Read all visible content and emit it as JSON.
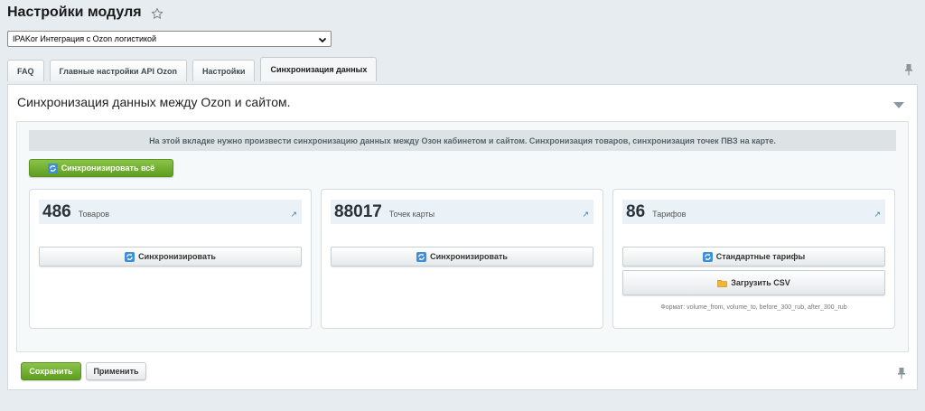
{
  "page": {
    "title": "Настройки модуля"
  },
  "module_select": {
    "value": "IPAKor Интеграция с Ozon логистикой"
  },
  "tabs": [
    {
      "label": "FAQ",
      "active": false
    },
    {
      "label": "Главные настройки API Ozon",
      "active": false
    },
    {
      "label": "Настройки",
      "active": false
    },
    {
      "label": "Синхронизация данных",
      "active": true
    }
  ],
  "panel": {
    "title": "Синхронизация данных между Ozon и сайтом.",
    "notice": "На этой вкладке нужно произвести синхронизацию данных между Озон кабинетом и сайтом. Синхронизация товаров, синхронизация точек ПВЗ на карте.",
    "sync_all_label": "Синхронизировать всё"
  },
  "cards": [
    {
      "count": "486",
      "label": "Товаров",
      "button": "Синхронизировать"
    },
    {
      "count": "88017",
      "label": "Точек карты",
      "button": "Синхронизировать"
    },
    {
      "count": "86",
      "label": "Тарифов",
      "button": "Стандартные тарифы",
      "upload_button": "Загрузить CSV",
      "format_note": "Формат: volume_from, volume_to, before_300_rub, after_300_rub"
    }
  ],
  "footer": {
    "save_label": "Сохранить",
    "apply_label": "Применить"
  },
  "icons": {
    "arrow_glyph": "↗"
  },
  "colors": {
    "accent_green": "#6aab26",
    "background": "#e6ecef",
    "notice_bg": "#dde3e5",
    "card_head_bg": "#eaf2f8"
  }
}
